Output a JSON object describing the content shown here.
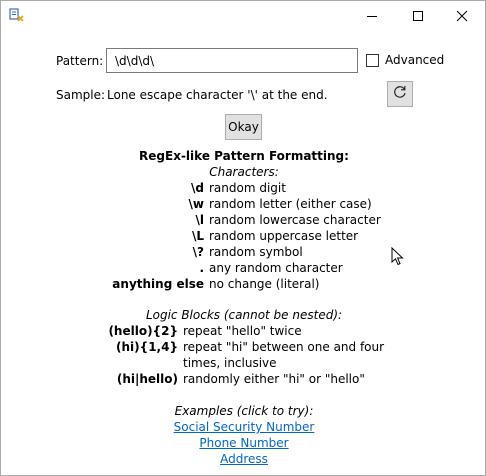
{
  "icons": {
    "app": "regex-tool-icon",
    "minimize": "minimize-icon",
    "maximize": "maximize-icon",
    "close": "close-icon",
    "refresh": "refresh-icon",
    "cursor": "mouse-pointer-icon"
  },
  "form": {
    "pattern_label": "Pattern:",
    "pattern_value": "\\d\\d\\d\\",
    "advanced_label": "Advanced",
    "advanced_checked": false,
    "sample_label": "Sample:",
    "sample_value": "Lone escape character '\\' at the end.",
    "ok_label": "Okay"
  },
  "help": {
    "heading": "RegEx-like Pattern Formatting:",
    "characters_heading": "Characters:",
    "characters": [
      {
        "syntax": "\\d",
        "description": "random digit"
      },
      {
        "syntax": "\\w",
        "description": "random letter (either case)"
      },
      {
        "syntax": "\\l",
        "description": "random lowercase character"
      },
      {
        "syntax": "\\L",
        "description": "random uppercase letter"
      },
      {
        "syntax": "\\?",
        "description": "random symbol"
      },
      {
        "syntax": ".",
        "description": "any random character"
      },
      {
        "syntax": "anything else",
        "description": "no change (literal)"
      }
    ],
    "logic_heading": "Logic Blocks (cannot be nested):",
    "logic": [
      {
        "syntax": "(hello){2}",
        "description": "repeat \"hello\" twice"
      },
      {
        "syntax": "(hi){1,4}",
        "description": "repeat \"hi\" between one and four",
        "description_cont": "times, inclusive"
      },
      {
        "syntax": "(hi|hello)",
        "description": "randomly either \"hi\" or \"hello\""
      }
    ],
    "examples_heading": "Examples (click to try):",
    "examples": [
      "Social Security Number",
      "Phone Number",
      "Address"
    ]
  },
  "colors": {
    "link": "#0066cc",
    "button_face": "#e1e1e1"
  }
}
